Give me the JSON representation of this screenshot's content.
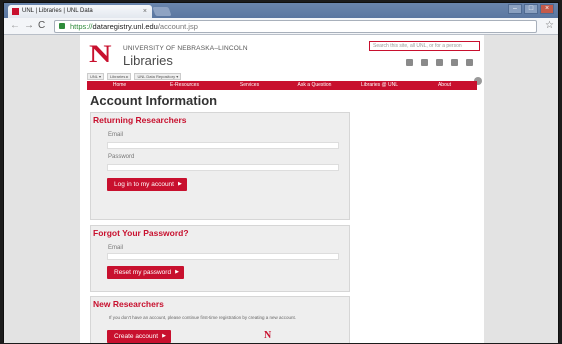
{
  "browser": {
    "tab_title": "UNL | Libraries | UNL Data",
    "tab_close": "×",
    "url_scheme": "https://",
    "url_host": "dataregistry.unl.edu",
    "url_path": "/account.jsp",
    "back": "←",
    "forward": "→",
    "reload": "C",
    "star": "☆",
    "window_minimize": "–",
    "window_maximize": "□",
    "window_close": "×"
  },
  "header": {
    "logo_mark": "N",
    "university": "UNIVERSITY OF NEBRASKA–LINCOLN",
    "libraries": "Libraries",
    "search_placeholder": "Search this site, all UNL, or for a person",
    "breadcrumbs": [
      "UNL ▾",
      "Libraries ▸",
      "UNL Data Repository ▾"
    ]
  },
  "nav": [
    "Home",
    "E-Resources",
    "Services",
    "Ask a Question",
    "Libraries @ UNL",
    "About"
  ],
  "main": {
    "title": "Account Information",
    "returning": {
      "title": "Returning Researchers",
      "email_label": "Email",
      "password_label": "Password",
      "button": "Log in to my account"
    },
    "forgot": {
      "title": "Forgot Your Password?",
      "email_label": "Email",
      "button": "Reset my password"
    },
    "new": {
      "title": "New Researchers",
      "note": "If you don't have an account, please continue first-time registration by creating a new account.",
      "button": "Create account"
    },
    "button_arrow": "▶"
  },
  "footer": {
    "logo_mark": "N"
  },
  "colors": {
    "brand_red": "#c8102e",
    "panel_bg": "#eeeeee",
    "page_bg": "#e3e3e3"
  }
}
